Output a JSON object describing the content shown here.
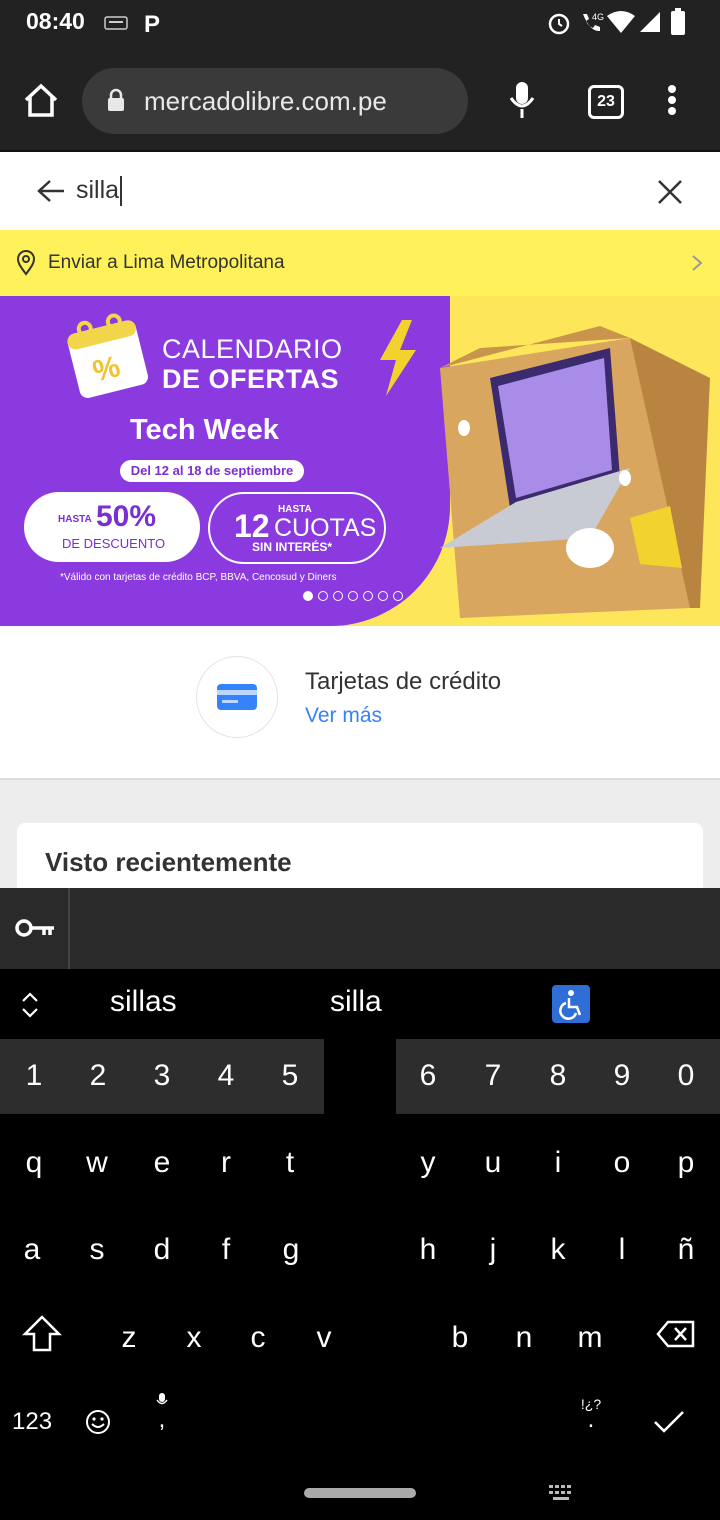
{
  "status_bar": {
    "time": "08:40"
  },
  "browser": {
    "url": "mercadolibre.com.pe",
    "tab_count": "23"
  },
  "search": {
    "query": "silla"
  },
  "location": {
    "label": "Enviar a Lima Metropolitana"
  },
  "banner": {
    "title_line1": "CALENDARIO",
    "title_line2": "DE OFERTAS",
    "subtitle": "Tech Week",
    "dates": "Del 12 al 18 de septiembre",
    "offer1_prefix": "HASTA",
    "offer1_value": "50%",
    "offer1_suffix": "DE DESCUENTO",
    "offer2_prefix": "HASTA",
    "offer2_number": "12",
    "offer2_word": "CUOTAS",
    "offer2_suffix": "SIN INTERÉS*",
    "disclaimer": "*Válido con tarjetas de crédito BCP, BBVA, Cencosud y Diners",
    "slide_count": 7,
    "active_slide": 1
  },
  "credit_card": {
    "title": "Tarjetas de crédito",
    "link": "Ver más"
  },
  "recent": {
    "title": "Visto recientemente"
  },
  "keyboard": {
    "suggestions": [
      "sillas",
      "silla"
    ],
    "numbers_left": [
      "1",
      "2",
      "3",
      "4",
      "5"
    ],
    "numbers_right": [
      "6",
      "7",
      "8",
      "9",
      "0"
    ],
    "row1_left": [
      "q",
      "w",
      "e",
      "r",
      "t"
    ],
    "row1_right": [
      "y",
      "u",
      "i",
      "o",
      "p"
    ],
    "row2_left": [
      "a",
      "s",
      "d",
      "f",
      "g"
    ],
    "row2_right": [
      "h",
      "j",
      "k",
      "l",
      "ñ"
    ],
    "row3_left": [
      "z",
      "x",
      "c",
      "v"
    ],
    "row3_right": [
      "b",
      "n",
      "m"
    ],
    "symbols_key": "123",
    "comma_key": ",",
    "period_key": ".",
    "punct_hint": "!¿?"
  },
  "colors": {
    "brand_yellow": "#fff159",
    "banner_purple": "#8b3ae0",
    "link_blue": "#3483fa"
  }
}
